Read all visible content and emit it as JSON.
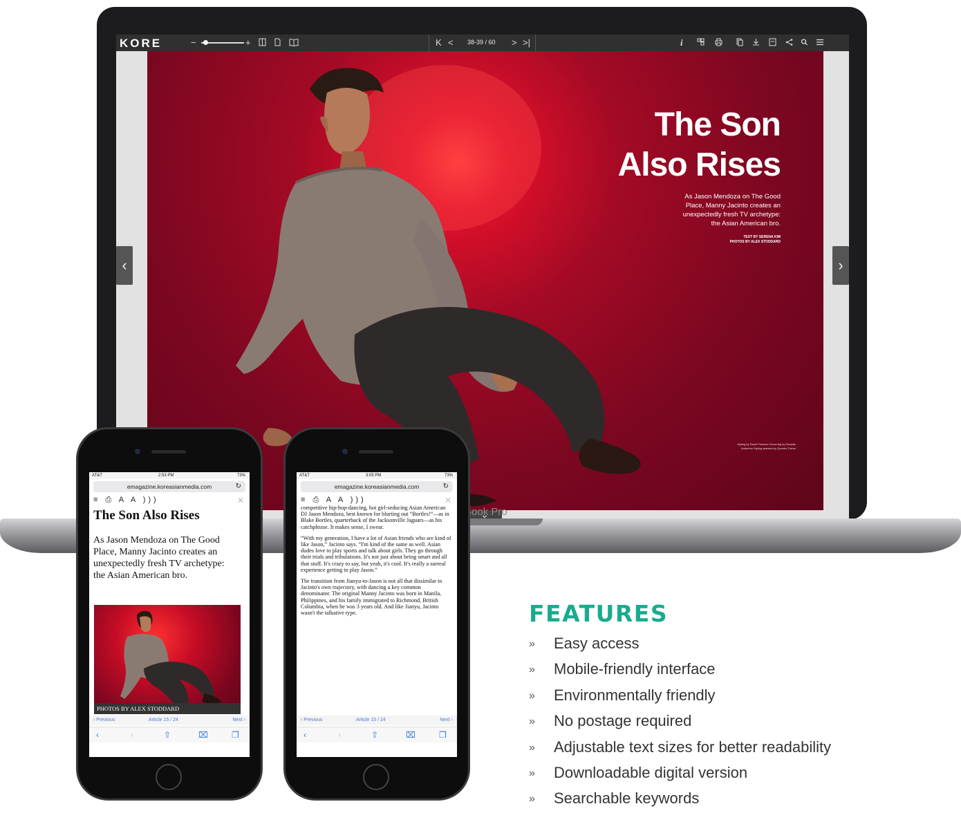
{
  "laptop": {
    "model_text": "Book Pro",
    "reader": {
      "logo": "KORE",
      "zoom_minus": "−",
      "zoom_plus": "+",
      "nav_first": "K",
      "nav_prev": "<",
      "page_counter": "38-39 / 60",
      "nav_next": ">",
      "nav_last": ">|",
      "info_label": "i"
    },
    "spread": {
      "headline_line1": "The Son",
      "headline_line2": "Also Rises",
      "deck_line1": "As Jason Mendoza on The Good",
      "deck_line2": "Place, Manny Jacinto creates an",
      "deck_line3": "unexpectedly fresh TV archetype:",
      "deck_line4": "the Asian American bro.",
      "credit_text": "TEXT BY SERENA KIM",
      "credit_photos": "PHOTOS BY ALEX STODDARD",
      "styling_note": "Styling by Rachi Pinsmec Grooming by Danielle Katherine Styling assisted by Quentin Turner"
    },
    "left_arrow": "‹",
    "right_arrow": "›",
    "collapse_chevron": "⌄"
  },
  "phone_left": {
    "carrier": "AT&T",
    "time": "2:53 PM",
    "battery": "73%",
    "url": "emagazine.koreasianmedia.com",
    "reader_tools": "≡ ⎙ A A )))",
    "title": "The Son Also Rises",
    "deck": "As Jason Mendoza on The Good Place, Manny Jacinto creates an unexpectedly fresh TV archetype: the Asian American bro.",
    "photo_caption": "PHOTOS BY ALEX STODDARD",
    "prev": "‹ Previous",
    "article_count": "Article 15 / 24",
    "next": "Next ›"
  },
  "phone_right": {
    "carrier": "AT&T",
    "time": "3:05 PM",
    "battery": "73%",
    "url": "emagazine.koreasianmedia.com",
    "reader_tools": "≡ ⎙ A A )))",
    "paragraph1": "competitive hip-hop-dancing, hot girl-seducing Asian American DJ Jason Mendoza, best known for blurting out “Bortles!”—as in Blake Bortles, quarterback of the Jacksonville Jaguars—as his catchphrase. It makes sense, I swear.",
    "paragraph2": "“With my generation, I have a lot of Asian friends who are kind of like Jason,” Jacinto says. “I'm kind of the same as well. Asian dudes love to play sports and talk about girls. They go through their trials and tribulations. It's not just about being smart and all that stuff. It's crazy to say, but yeah, it's cool. It's really a surreal experience getting to play Jason.”",
    "paragraph3": "The transition from Jianyu-to-Jason is not all that dissimilar to Jacinto's own trajectory, with dancing a key common denominator. The original Manny Jacinto was born in Manila, Philippines, and his family immigrated to Richmond, British Columbia, when he was 3 years old. And like Jianyu, Jacinto wasn't the talkative type.",
    "prev": "‹ Previous",
    "article_count": "Article 15 / 24",
    "next": "Next ›"
  },
  "features": {
    "title": "FEATURES",
    "bullet": "»",
    "items": [
      "Easy access",
      "Mobile-friendly interface",
      "Environmentally friendly",
      "No postage required",
      "Adjustable text sizes for better readability",
      "Downloadable digital version",
      "Searchable keywords"
    ]
  },
  "colors": {
    "accent": "#1aab8f",
    "magazine_red": "#a30a25",
    "toolbar": "#303030"
  }
}
